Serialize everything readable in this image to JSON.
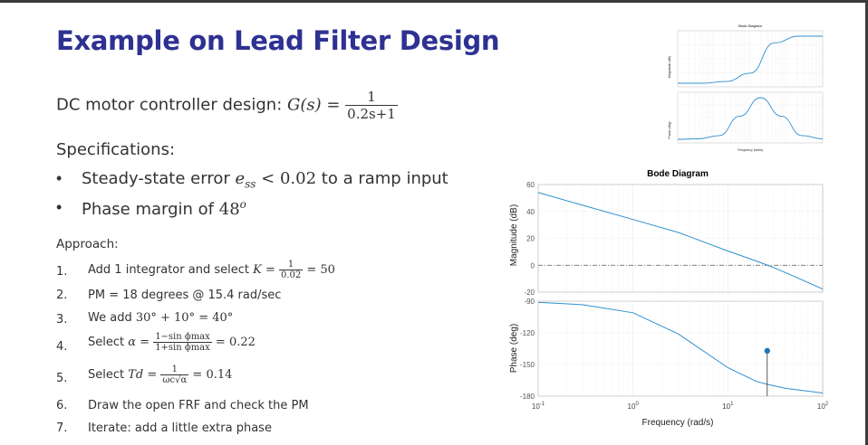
{
  "slide": {
    "title": "Example on Lead Filter Design",
    "dc_motor": {
      "prefix": "DC motor controller design: ",
      "G": "G(s) = ",
      "num": "1",
      "den": "0.2s+1"
    },
    "specs_heading": "Specifications:",
    "specs": [
      {
        "bullet": "•",
        "pre": "Steady-state error ",
        "math": "e",
        "sub": "ss",
        "post_math": " < 0.02",
        "post": " to a ramp input"
      },
      {
        "bullet": "•",
        "pre": "Phase margin of ",
        "math": "48",
        "sup": "o",
        "post_math": "",
        "post": ""
      }
    ],
    "approach_heading": "Approach:",
    "steps": [
      {
        "n": "1.",
        "text": "Add 1 integrator and select ",
        "math": "K = ",
        "num": "1",
        "den": "0.02",
        "tail": " = 50"
      },
      {
        "n": "2.",
        "text": "PM = 18 degrees @ 15.4 rad/sec"
      },
      {
        "n": "3.",
        "text": "We add ",
        "math": "30° + 10° = 40°"
      },
      {
        "n": "4.",
        "text": "Select ",
        "math": "α = ",
        "num": "1−sin ϕmax",
        "den": "1+sin ϕmax",
        "tail": " = 0.22"
      },
      {
        "n": "5.",
        "text": "Select ",
        "math": "Td = ",
        "num": "1",
        "den": "ωc√α",
        "tail": " = 0.14"
      },
      {
        "n": "6.",
        "text": "Draw the open FRF and check the PM"
      },
      {
        "n": "7.",
        "text": "Iterate: add a little extra phase"
      }
    ]
  },
  "chart_data": [
    {
      "type": "line",
      "title": "Bode Diagram",
      "xlabel": "Frequency (rad/s)",
      "x_scale": "log",
      "xlim": [
        0.1,
        100
      ],
      "x_ticks": [
        "10^-1",
        "10^0",
        "10^1",
        "10^2"
      ],
      "colors": {
        "line": "#2f8fd0",
        "marker": "#1f77b4",
        "zero_line": "#555555"
      },
      "panels": [
        {
          "name": "magnitude",
          "ylabel": "Magnitude (dB)",
          "ylim": [
            -20,
            60
          ],
          "y_ticks": [
            60,
            40,
            20,
            0,
            -20
          ],
          "series": [
            {
              "x": [
                0.1,
                0.3,
                1,
                3,
                10,
                20,
                30,
                50,
                100
              ],
              "values": [
                54,
                44.5,
                34,
                24.4,
                10.6,
                3.1,
                -1.6,
                -8.3,
                -17.7
              ]
            }
          ]
        },
        {
          "name": "phase",
          "ylabel": "Phase (deg)",
          "ylim": [
            -180,
            -90
          ],
          "y_ticks": [
            -90,
            -120,
            -150,
            -180
          ],
          "series": [
            {
              "x": [
                0.1,
                0.3,
                1,
                3,
                10,
                20,
                26,
                40,
                100
              ],
              "values": [
                -91,
                -93.4,
                -101,
                -121,
                -153,
                -166,
                -168.8,
                -172.5,
                -177
              ]
            }
          ],
          "marker": {
            "x": 26,
            "y": -137
          }
        }
      ],
      "grid": true
    },
    {
      "type": "line",
      "title": "Bode Diagram",
      "xlabel": "Frequency (rad/s)",
      "x_scale": "log",
      "panels": [
        {
          "name": "magnitude",
          "ylabel": "Magnitude (dB)",
          "series": [
            {
              "values": [
                0,
                0,
                0.5,
                3,
                12,
                14,
                14
              ]
            }
          ]
        },
        {
          "name": "phase",
          "ylabel": "Phase (deg)",
          "series": [
            {
              "values": [
                0,
                0.5,
                4,
                25,
                45,
                25,
                4,
                0.5
              ]
            }
          ]
        }
      ],
      "grid": true
    }
  ]
}
